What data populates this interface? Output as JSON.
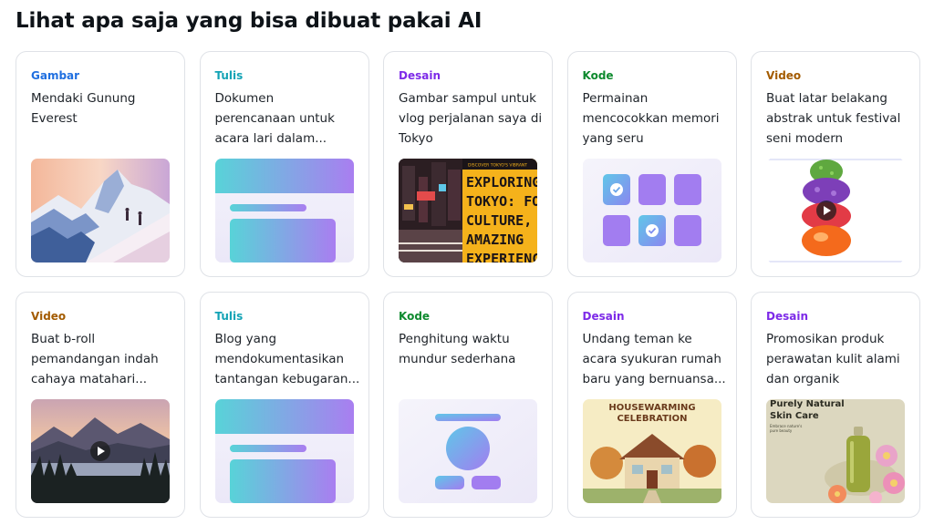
{
  "heading": "Lihat apa saja yang bisa dibuat pakai AI",
  "cards": [
    {
      "category": "Gambar",
      "lines": [
        "Mendaki Gunung",
        "Everest",
        ""
      ]
    },
    {
      "category": "Tulis",
      "lines": [
        "Dokumen",
        "perencanaan untuk",
        "acara lari dalam..."
      ]
    },
    {
      "category": "Desain",
      "lines": [
        "Gambar sampul untuk",
        "vlog perjalanan saya di",
        "Tokyo"
      ]
    },
    {
      "category": "Kode",
      "lines": [
        "Permainan",
        "mencocokkan memori",
        "yang seru"
      ]
    },
    {
      "category": "Video",
      "lines": [
        "Buat latar belakang",
        "abstrak untuk festival",
        "seni modern"
      ]
    },
    {
      "category": "Video",
      "lines": [
        "Buat b-roll",
        "pemandangan indah",
        "cahaya matahari..."
      ]
    },
    {
      "category": "Tulis",
      "lines": [
        "Blog yang",
        "mendokumentasikan",
        "tantangan kebugaran..."
      ]
    },
    {
      "category": "Kode",
      "lines": [
        "Penghitung waktu",
        "mundur sederhana",
        ""
      ]
    },
    {
      "category": "Desain",
      "lines": [
        "Undang teman ke",
        "acara syukuran rumah",
        "baru yang bernuansa..."
      ]
    },
    {
      "category": "Desain",
      "lines": [
        "Promosikan produk",
        "perawatan kulit alami",
        "dan organik"
      ]
    }
  ],
  "thumb_text": {
    "tokyo_banner": "DISCOVER TOKYO'S VIBRANT",
    "tokyo_lines": [
      "EXPLORING",
      "TOKYO: FO",
      "CULTURE,",
      "AMAZING",
      "EXPERIENC"
    ],
    "housewarming": [
      "HOUSEWARMING",
      "CELEBRATION"
    ],
    "skincare": [
      "Purely Natural",
      "Skin Care",
      "Embrace nature's",
      "pure beauty"
    ]
  },
  "colors": {
    "desain": "#7d2ae8",
    "gambar": "#1f6fe0",
    "tulis": "#13a3b5",
    "kode": "#0e8a2e",
    "video": "#a35b00"
  }
}
